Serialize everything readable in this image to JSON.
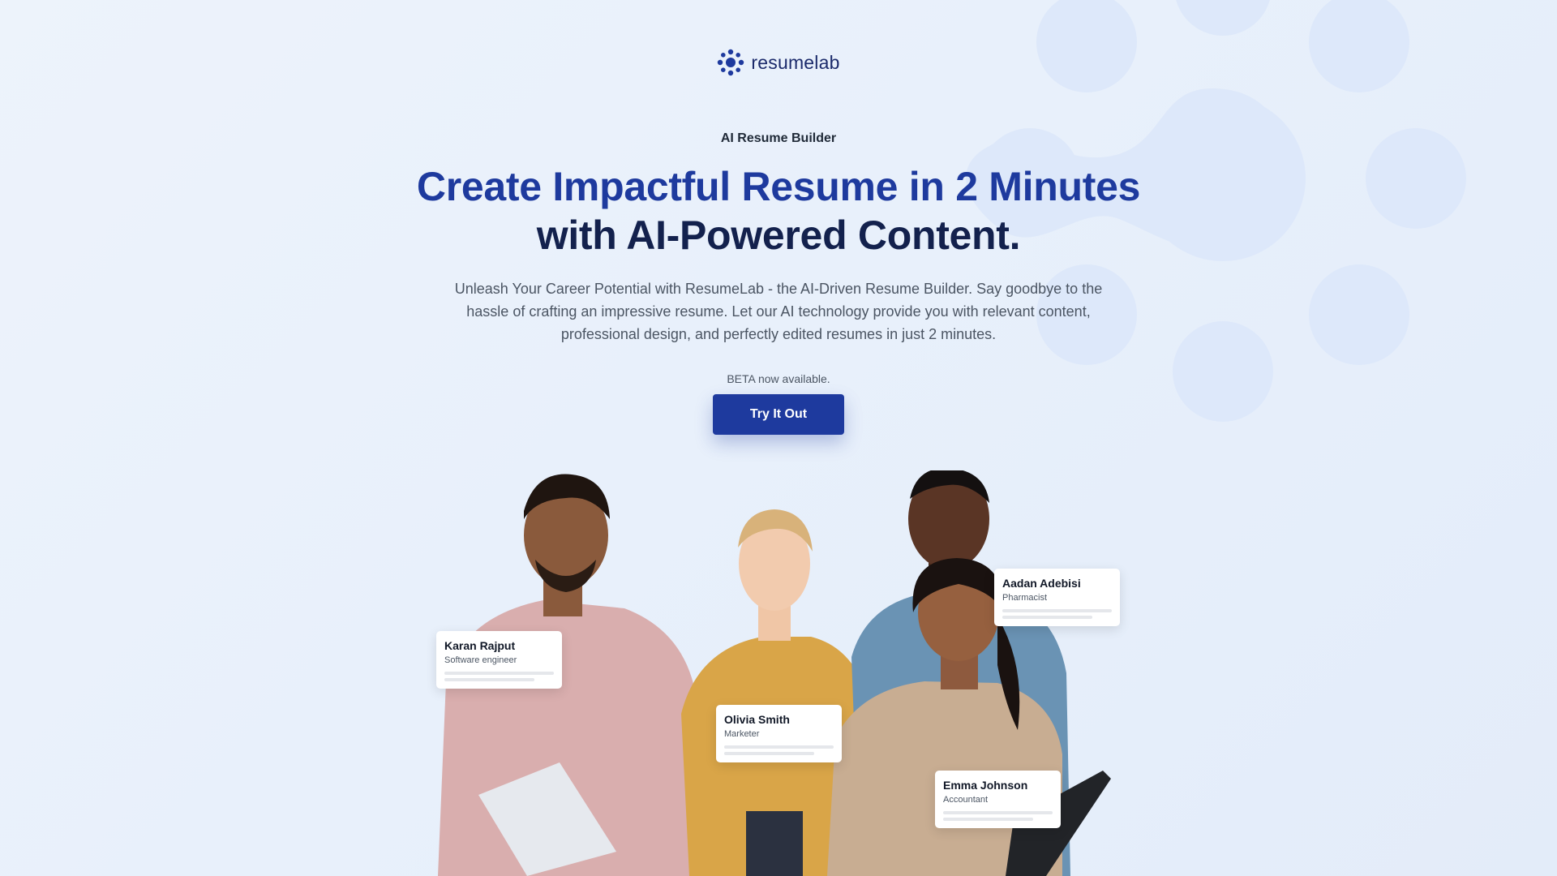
{
  "brand": {
    "name": "resumelab"
  },
  "hero": {
    "eyebrow": "AI Resume Builder",
    "headline_accent": "Create Impactful Resume in 2 Minutes",
    "headline_rest": "with AI-Powered Content.",
    "description": "Unleash Your Career Potential with ResumeLab - the AI-Driven Resume Builder. Say goodbye to the hassle of crafting an impressive resume. Let our AI technology provide you with relevant content, professional design, and perfectly edited resumes in just 2 minutes.",
    "beta_note": "BETA now available.",
    "cta_label": "Try It Out"
  },
  "profiles": [
    {
      "name": "Karan Rajput",
      "role": "Software engineer"
    },
    {
      "name": "Olivia Smith",
      "role": "Marketer"
    },
    {
      "name": "Aadan Adebisi",
      "role": "Pharmacist"
    },
    {
      "name": "Emma Johnson",
      "role": "Accountant"
    }
  ],
  "colors": {
    "primary": "#1e3a9e",
    "headline_dark": "#13214d",
    "background": "#e8f0fb"
  }
}
